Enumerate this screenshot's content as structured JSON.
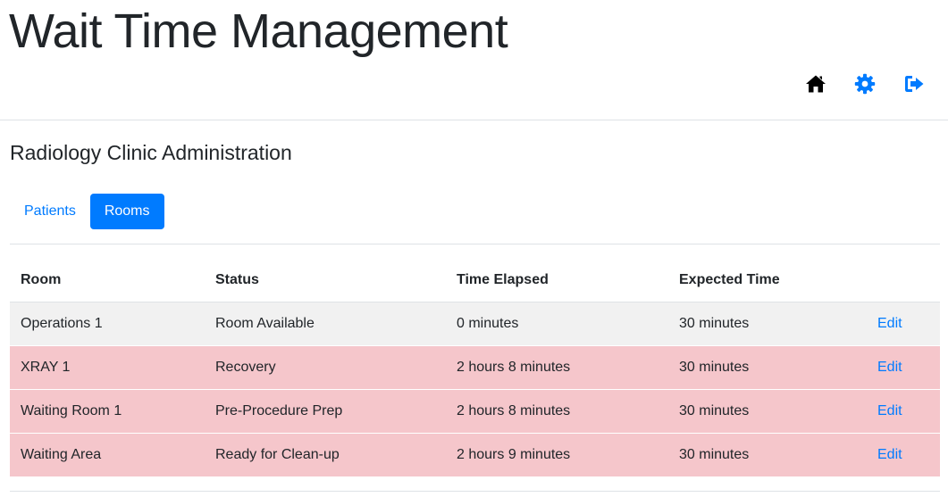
{
  "app": {
    "title": "Wait Time Management"
  },
  "header_icons": [
    {
      "name": "home-icon",
      "color": "#000000"
    },
    {
      "name": "gear-icon",
      "color": "#007bff"
    },
    {
      "name": "sign-out-icon",
      "color": "#007bff"
    }
  ],
  "page": {
    "subtitle": "Radiology Clinic Administration"
  },
  "tabs": [
    {
      "label": "Patients",
      "active": false
    },
    {
      "label": "Rooms",
      "active": true
    }
  ],
  "table": {
    "headers": [
      "Room",
      "Status",
      "Time Elapsed",
      "Expected Time",
      ""
    ],
    "rows": [
      {
        "room": "Operations 1",
        "status": "Room Available",
        "elapsed": "0 minutes",
        "expected": "30 minutes",
        "action": "Edit",
        "state": "available"
      },
      {
        "room": "XRAY 1",
        "status": "Recovery",
        "elapsed": "2 hours 8 minutes",
        "expected": "30 minutes",
        "action": "Edit",
        "state": "occupied"
      },
      {
        "room": "Waiting Room 1",
        "status": "Pre-Procedure Prep",
        "elapsed": "2 hours 8 minutes",
        "expected": "30 minutes",
        "action": "Edit",
        "state": "occupied"
      },
      {
        "room": "Waiting Area",
        "status": "Ready for Clean-up",
        "elapsed": "2 hours 9 minutes",
        "expected": "30 minutes",
        "action": "Edit",
        "state": "occupied"
      }
    ]
  },
  "colors": {
    "accent": "#007bff",
    "available_row": "#f1f1f1",
    "overdue_row": "#f5c6cb"
  }
}
